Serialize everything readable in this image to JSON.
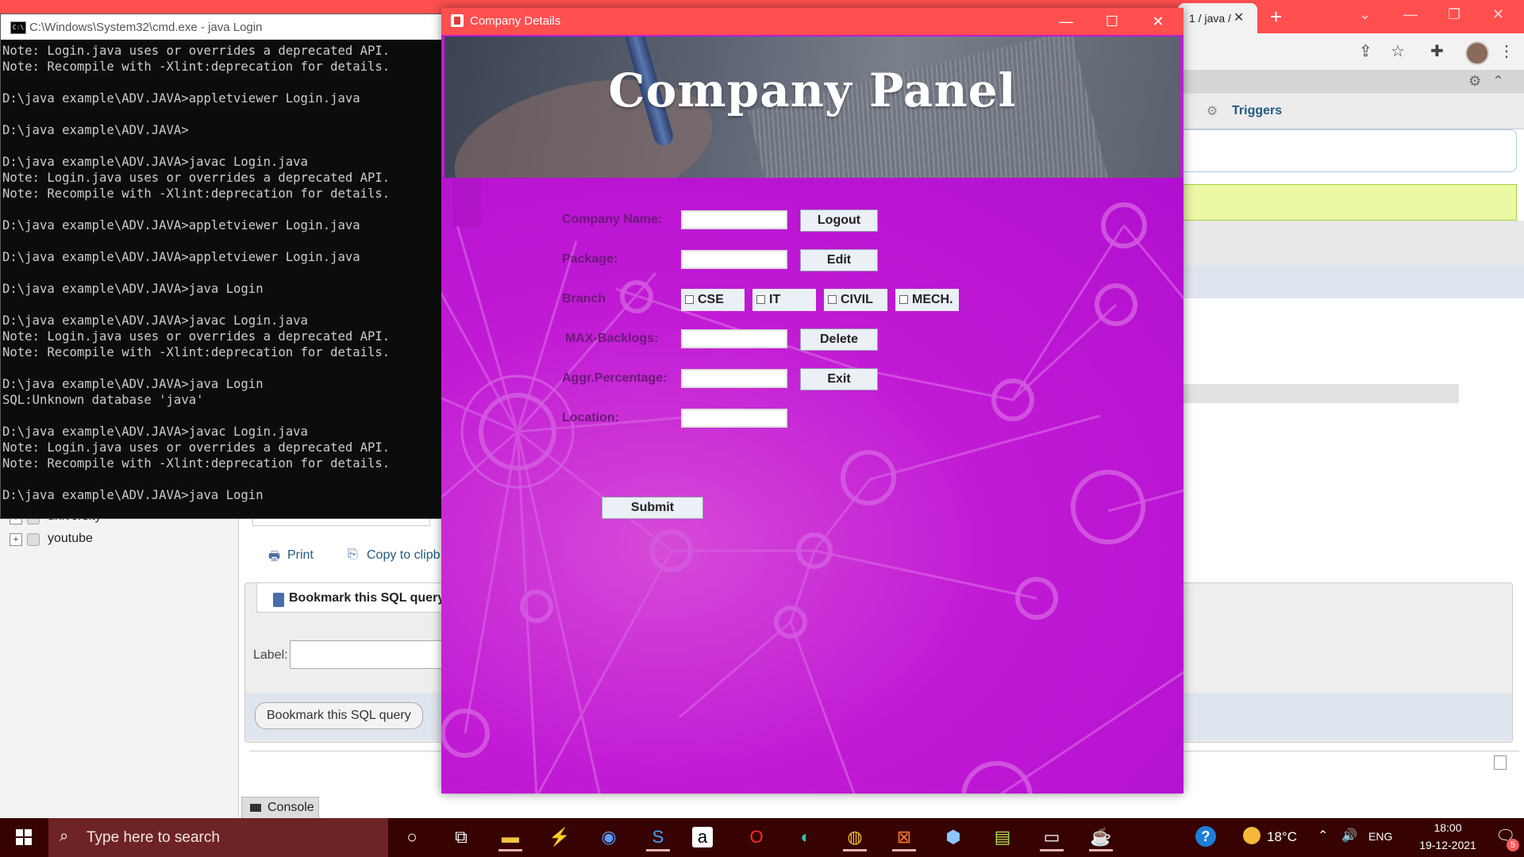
{
  "browser": {
    "tab_title": "1 / java /",
    "triggers_tab": "Triggers",
    "tree_items": [
      "university",
      "youtube"
    ],
    "print_label": "Print",
    "copy_label": "Copy to clipb",
    "bookmark_title": "Bookmark this SQL query",
    "label_text": "Label:",
    "bookmark_button": "Bookmark this SQL query",
    "console_tab": "Console"
  },
  "cmd": {
    "title": "C:\\Windows\\System32\\cmd.exe - java  Login",
    "lines": [
      "Note: Login.java uses or overrides a deprecated API.",
      "Note: Recompile with -Xlint:deprecation for details.",
      "",
      "D:\\java example\\ADV.JAVA>appletviewer Login.java",
      "",
      "D:\\java example\\ADV.JAVA>",
      "",
      "D:\\java example\\ADV.JAVA>javac Login.java",
      "Note: Login.java uses or overrides a deprecated API.",
      "Note: Recompile with -Xlint:deprecation for details.",
      "",
      "D:\\java example\\ADV.JAVA>appletviewer Login.java",
      "",
      "D:\\java example\\ADV.JAVA>appletviewer Login.java",
      "",
      "D:\\java example\\ADV.JAVA>java Login",
      "",
      "D:\\java example\\ADV.JAVA>javac Login.java",
      "Note: Login.java uses or overrides a deprecated API.",
      "Note: Recompile with -Xlint:deprecation for details.",
      "",
      "D:\\java example\\ADV.JAVA>java Login",
      "SQL:Unknown database 'java'",
      "",
      "D:\\java example\\ADV.JAVA>javac Login.java",
      "Note: Login.java uses or overrides a deprecated API.",
      "Note: Recompile with -Xlint:deprecation for details.",
      "",
      "D:\\java example\\ADV.JAVA>java Login"
    ]
  },
  "company_window": {
    "title": "Company Details",
    "heading": "Company Panel",
    "labels": {
      "company_name": "Company Name:",
      "package": "Package:",
      "branch": "Branch",
      "max_backlogs": "MAX-Backlogs:",
      "aggr_percentage": "Aggr.Percentage:",
      "location": "Location:"
    },
    "fields": {
      "company_name": "",
      "package": "",
      "max_backlogs": "",
      "aggr_percentage": "",
      "location": ""
    },
    "branches": [
      {
        "label": "CSE",
        "checked": false
      },
      {
        "label": "IT",
        "checked": false
      },
      {
        "label": "CIVIL",
        "checked": false
      },
      {
        "label": "MECH.",
        "checked": false
      }
    ],
    "buttons": {
      "logout": "Logout",
      "edit": "Edit",
      "delete": "Delete",
      "exit": "Exit",
      "submit": "Submit"
    }
  },
  "taskbar": {
    "search_placeholder": "Type here to search",
    "temperature": "18°C",
    "language": "ENG",
    "time": "18:00",
    "date": "19-12-2021",
    "notification_count": "5"
  }
}
